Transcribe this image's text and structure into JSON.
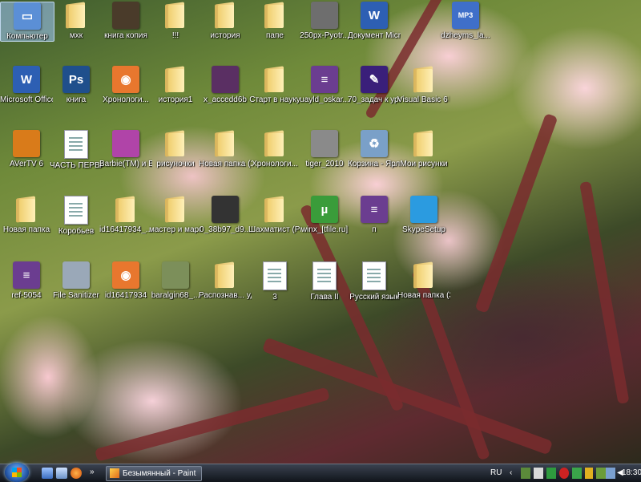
{
  "desktop": {
    "icons": [
      {
        "label": "Компьютер",
        "type": "computer",
        "color": "#5b8fd6",
        "selected": true
      },
      {
        "label": "мхк",
        "type": "folder"
      },
      {
        "label": "книга копия",
        "type": "image",
        "color": "#4a3b2a"
      },
      {
        "label": "!!!",
        "type": "folder"
      },
      {
        "label": "история",
        "type": "folder"
      },
      {
        "label": "папе",
        "type": "folder"
      },
      {
        "label": "250px-Pyotr...",
        "type": "image",
        "color": "#6e6e6e"
      },
      {
        "label": "Документ Microso...",
        "type": "word",
        "color": "#2d5fb3"
      },
      {
        "label": "dzheyms_la...",
        "type": "mp3",
        "color": "#3f6fc9"
      },
      {
        "label": "Microsoft Office Wo...",
        "type": "word",
        "color": "#2d5fb3"
      },
      {
        "label": "книга",
        "type": "psd",
        "color": "#1f4f8c"
      },
      {
        "label": "Хронологи...",
        "type": "firefox",
        "color": "#e8772e"
      },
      {
        "label": "история1",
        "type": "folder"
      },
      {
        "label": "x_accedd6b",
        "type": "image",
        "color": "#5a2f63"
      },
      {
        "label": "Старт в науку",
        "type": "folder"
      },
      {
        "label": "uayld_oskar...",
        "type": "rar",
        "color": "#6b3d90"
      },
      {
        "label": "70_задач к урокам ге...",
        "type": "pencil",
        "color": "#3a1f7a"
      },
      {
        "label": "Visual Basic 6 Rus",
        "type": "folder"
      },
      {
        "label": "AVerTV 6",
        "type": "app",
        "color": "#d97b1a"
      },
      {
        "label": "ЧАСТЬ ПЕРВАЯ",
        "type": "doc"
      },
      {
        "label": "Barbie(TM) и Волшебст...",
        "type": "app",
        "color": "#b044a8"
      },
      {
        "label": "рисуночки",
        "type": "folder"
      },
      {
        "label": "Новая папка (2)",
        "type": "folder"
      },
      {
        "label": "Хронологи...",
        "type": "folder"
      },
      {
        "label": "tiger_2010",
        "type": "image",
        "color": "#8a8a8a"
      },
      {
        "label": "Корзина - Ярлык",
        "type": "recycle",
        "color": "#7aa0c8"
      },
      {
        "label": "Мои рисунки",
        "type": "folder"
      },
      {
        "label": "Новая папка",
        "type": "folder"
      },
      {
        "label": "Коробьев",
        "type": "doc"
      },
      {
        "label": "id16417934_...",
        "type": "folder"
      },
      {
        "label": "мастер и маргарита",
        "type": "folder"
      },
      {
        "label": "0_38b97_d9...",
        "type": "image",
        "color": "#333333"
      },
      {
        "label": "Шахматист (Рыночны...",
        "type": "folder"
      },
      {
        "label": "winx_[tfile.ru]",
        "type": "utorrent",
        "color": "#3a9c3a"
      },
      {
        "label": "п",
        "type": "rar",
        "color": "#6b3d90"
      },
      {
        "label": "SkypeSetup",
        "type": "app",
        "color": "#2b9be0"
      },
      {
        "label": "ref-5054",
        "type": "rar",
        "color": "#6b3d90"
      },
      {
        "label": "File Sanitizer",
        "type": "app",
        "color": "#9aa8b8"
      },
      {
        "label": "id16417934",
        "type": "firefox",
        "color": "#e8772e"
      },
      {
        "label": "baralgin68_...",
        "type": "image",
        "color": "#7c8f5a"
      },
      {
        "label": "Распознав... удобрений",
        "type": "folder"
      },
      {
        "label": "3",
        "type": "doc"
      },
      {
        "label": "Глава II",
        "type": "doc"
      },
      {
        "label": "Русский язык",
        "type": "doc"
      },
      {
        "label": "Новая папка (3)",
        "type": "folder"
      }
    ]
  },
  "taskbar": {
    "start_label": "",
    "active_task": "Безымянный - Paint",
    "language": "RU",
    "clock": "18:30"
  },
  "colors": {
    "taskbar_bg": "#10141a",
    "start_orb": "#1d4c9a"
  }
}
